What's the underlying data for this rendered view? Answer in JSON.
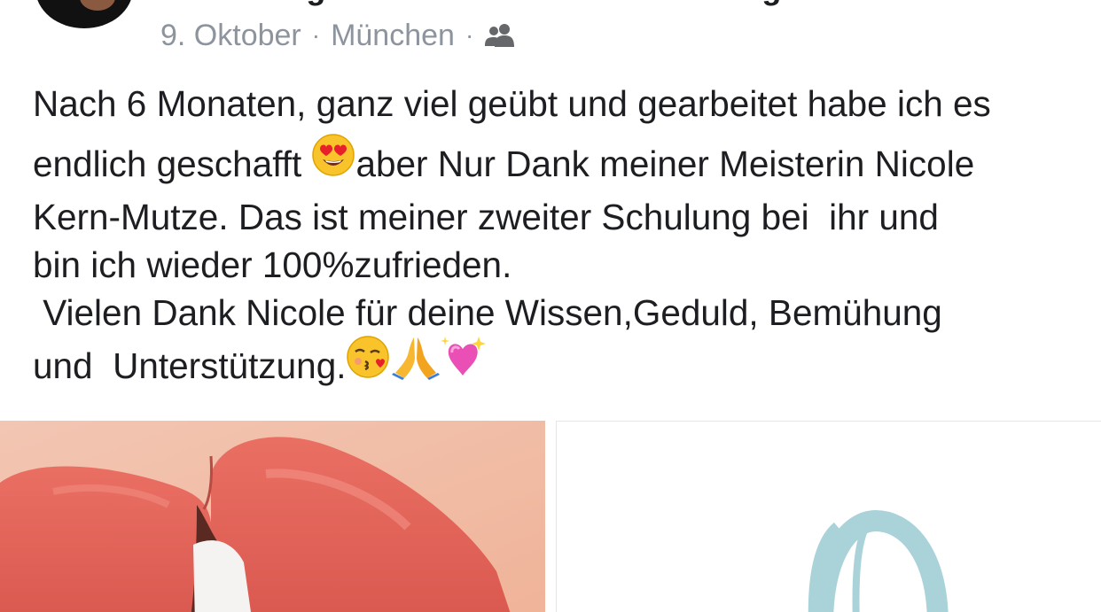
{
  "post": {
    "author": "rier Avantgarde München & Microblading.",
    "date": "9. Oktober",
    "separator": "·",
    "location": "München",
    "audience_icon": "friends-icon",
    "text_lines": [
      "Nach 6 Monaten, ganz viel geübt und gearbeitet habe ich es",
      "endlich geschafft ",
      "aber Nur Dank meiner Meisterin Nicole",
      "Kern-Mutze. Das ist meiner zweiter Schulung bei  ihr und",
      "bin ich wieder 100%zufrieden.",
      " Vielen Dank Nicole für deine Wissen,Geduld, Bemühung",
      "und  Unterstützung."
    ],
    "emojis": {
      "heart_eyes": "heart-eyes-emoji",
      "kiss": "face-blowing-kiss-emoji",
      "pray": "folded-hands-emoji",
      "sparkle_heart": "sparkling-heart-emoji"
    }
  },
  "photos": [
    {
      "name": "lips-photo",
      "subject": "lips-closeup"
    },
    {
      "name": "logo-photo",
      "subject": "circular-logo"
    }
  ],
  "colors": {
    "text": "#1c1e21",
    "meta": "#8d949e",
    "lips": "#e46a60",
    "skin": "#f3c1a6",
    "logo": "#a9d3d9"
  }
}
